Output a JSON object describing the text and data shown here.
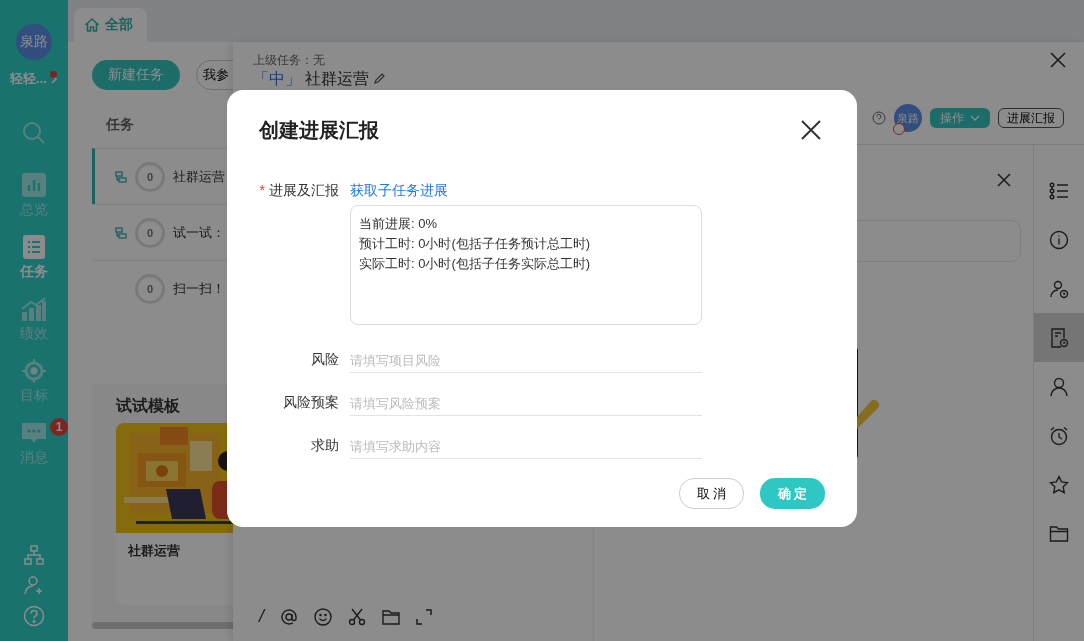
{
  "sidebar": {
    "avatar": "泉路",
    "user": "轻轻...",
    "user_unread": true,
    "items": [
      {
        "kind": "search",
        "selected": false
      },
      {
        "kind": "overview",
        "label": "总览",
        "selected": false
      },
      {
        "kind": "tasks",
        "label": "任务",
        "selected": true
      },
      {
        "kind": "performance",
        "label": "绩效",
        "selected": false
      },
      {
        "kind": "goals",
        "label": "目标",
        "selected": false
      },
      {
        "kind": "messages",
        "label": "消息",
        "badge": "1",
        "selected": false
      }
    ]
  },
  "tabs": [
    {
      "label": "全部",
      "selected": true
    }
  ],
  "toolbar": {
    "new_button": "新建任务",
    "filter_button": "我参"
  },
  "task_list": {
    "header": "任务",
    "rows": [
      {
        "title": "社群运营",
        "count": "0",
        "has_subtasks": true,
        "selected": true
      },
      {
        "title": "试一试：",
        "count": "0",
        "has_subtasks": true,
        "selected": false
      },
      {
        "title": "扫一扫！",
        "count": "0",
        "has_subtasks": false,
        "selected": false
      }
    ]
  },
  "templates": {
    "title": "试试模板",
    "cards": [
      {
        "kind": "picture",
        "name": "社群运营"
      }
    ]
  },
  "detail": {
    "parent": "上级任务：无",
    "priority": "「中」",
    "title": "社群运营",
    "owner_avatar": "泉路",
    "actions_button": "操作",
    "report_button": "进展汇报",
    "rail": [
      {
        "kind": "list",
        "selected": false
      },
      {
        "kind": "info",
        "selected": false
      },
      {
        "kind": "user-clock",
        "selected": false
      },
      {
        "kind": "report",
        "selected": true
      },
      {
        "kind": "user",
        "selected": false
      },
      {
        "kind": "alarm",
        "selected": false
      },
      {
        "kind": "star",
        "selected": false
      },
      {
        "kind": "folder",
        "selected": false
      }
    ],
    "editor_tools": [
      {
        "kind": "slash",
        "label": "/"
      },
      {
        "kind": "mention"
      },
      {
        "kind": "emoji"
      },
      {
        "kind": "scissors"
      },
      {
        "kind": "folder"
      },
      {
        "kind": "expand"
      }
    ]
  },
  "dialog": {
    "title": "创建进展汇报",
    "fields": [
      {
        "kind": "textarea",
        "label": "进展及汇报",
        "required": true,
        "required_mark": "*",
        "link": "获取子任务进展",
        "value": "当前进展: 0%\n预计工时: 0小时(包括子任务预计总工时)\n实际工时: 0小时(包括子任务实际总工时)"
      },
      {
        "kind": "line",
        "label": "风险",
        "placeholder": "请填写项目风险"
      },
      {
        "kind": "line",
        "label": "风险预案",
        "placeholder": "请填写风险预案"
      },
      {
        "kind": "line",
        "label": "求助",
        "placeholder": "请填写求助内容"
      }
    ],
    "buttons": [
      {
        "label": "取 消",
        "kind": "secondary"
      },
      {
        "label": "确 定",
        "kind": "primary"
      }
    ]
  }
}
